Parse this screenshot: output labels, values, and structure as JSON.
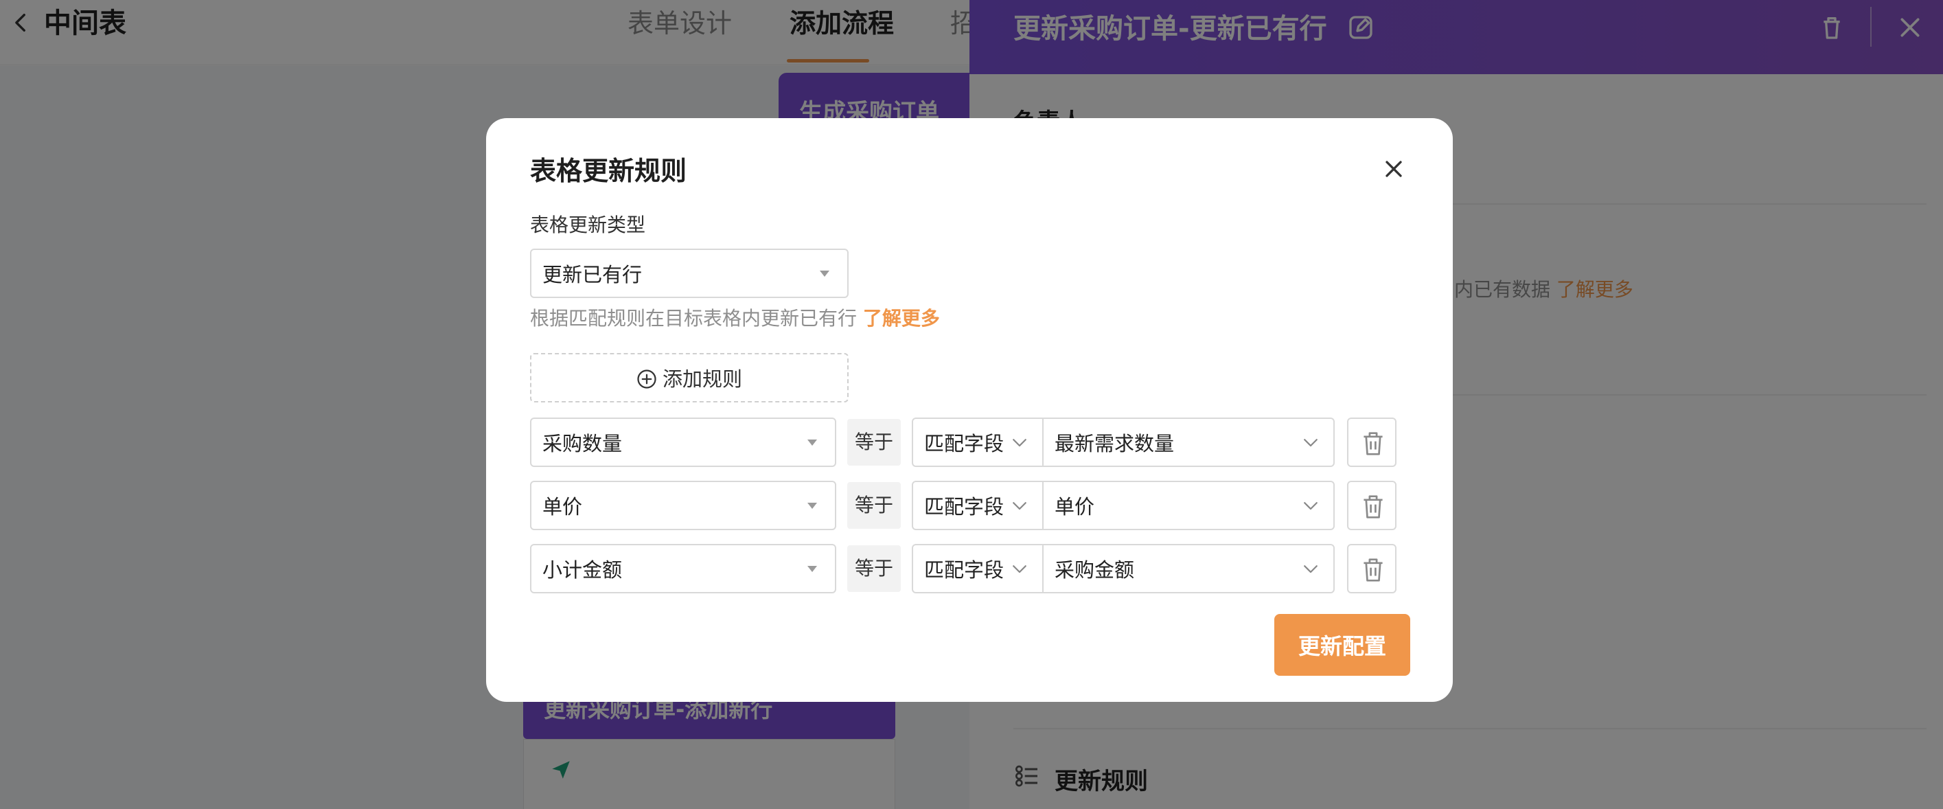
{
  "app": {
    "title": "中间表",
    "tabs": [
      {
        "label": "表单设计",
        "active": false
      },
      {
        "label": "添加流程",
        "active": true
      },
      {
        "label": "招",
        "active": false
      }
    ]
  },
  "canvas": {
    "card_top_label": "生成采购订单",
    "card_bottom_label": "更新采购订单-添加新行"
  },
  "side_panel": {
    "title": "更新采购订单-更新已有行",
    "owner_label": "负责人",
    "hint_text": "内已有数据 ",
    "hint_link": "了解更多",
    "rules_section_title": "更新规则"
  },
  "modal": {
    "title": "表格更新规则",
    "type_label": "表格更新类型",
    "type_value": "更新已有行",
    "help_text": "根据匹配规则在目标表格内更新已有行 ",
    "help_link": "了解更多",
    "add_rule_label": "添加规则",
    "submit_label": "更新配置",
    "rules": [
      {
        "source": "采购数量",
        "operator": "等于",
        "mode": "匹配字段",
        "target": "最新需求数量"
      },
      {
        "source": "单价",
        "operator": "等于",
        "mode": "匹配字段",
        "target": "单价"
      },
      {
        "source": "小计金额",
        "operator": "等于",
        "mode": "匹配字段",
        "target": "采购金额"
      }
    ]
  },
  "colors": {
    "accent": "#f0964a",
    "header_purple": "#7c52dc",
    "overlay": "rgba(0,0,0,0.5)"
  }
}
